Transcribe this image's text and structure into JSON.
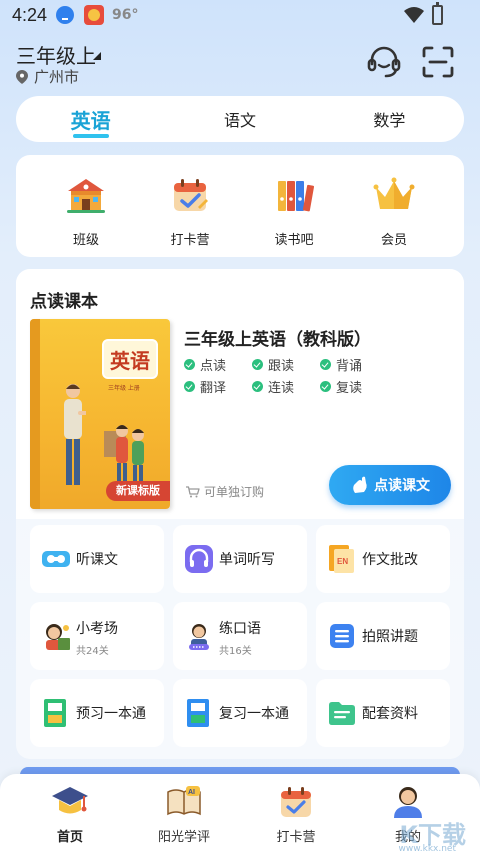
{
  "status_bar": {
    "time": "4:24",
    "temperature": "96°"
  },
  "header": {
    "grade": "三年级上",
    "location": "广州市"
  },
  "subject_tabs": [
    {
      "label": "英语",
      "active": true
    },
    {
      "label": "语文",
      "active": false
    },
    {
      "label": "数学",
      "active": false
    }
  ],
  "quick_entries": [
    {
      "label": "班级",
      "icon": "school-icon"
    },
    {
      "label": "打卡营",
      "icon": "checkin-calendar-icon"
    },
    {
      "label": "读书吧",
      "icon": "books-icon"
    },
    {
      "label": "会员",
      "icon": "crown-icon"
    }
  ],
  "textbook": {
    "section_title": "点读课本",
    "book_cover_title": "英语",
    "book_cover_grade": "三年级 上册",
    "book_badge": "新课标版",
    "book_name": "三年级上英语（教科版）",
    "features": [
      "点读",
      "跟读",
      "背诵",
      "翻译",
      "连读",
      "复读"
    ],
    "buy_link": "可单独订购",
    "read_button": "点读课文"
  },
  "tools": [
    {
      "label": "听课文",
      "sub": "",
      "icon": "listen-icon"
    },
    {
      "label": "单词听写",
      "sub": "",
      "icon": "headphones-icon"
    },
    {
      "label": "作文批改",
      "sub": "",
      "icon": "essay-icon"
    },
    {
      "label": "小考场",
      "sub": "共24关",
      "icon": "exam-girl-icon"
    },
    {
      "label": "练口语",
      "sub": "共16关",
      "icon": "speaking-boy-icon"
    },
    {
      "label": "拍照讲题",
      "sub": "",
      "icon": "photo-list-icon"
    },
    {
      "label": "预习一本通",
      "sub": "",
      "icon": "preview-book-icon"
    },
    {
      "label": "复习一本通",
      "sub": "",
      "icon": "review-book-icon"
    },
    {
      "label": "配套资料",
      "sub": "",
      "icon": "folder-icon"
    }
  ],
  "bottom_nav": [
    {
      "label": "首页",
      "active": true,
      "icon": "graduation-cap-icon"
    },
    {
      "label": "阳光学评",
      "active": false,
      "icon": "ai-book-icon"
    },
    {
      "label": "打卡营",
      "active": false,
      "icon": "checkin-calendar-icon"
    },
    {
      "label": "我的",
      "active": false,
      "icon": "profile-icon"
    }
  ],
  "watermark": {
    "text": "K下载",
    "sub": "www.kkx.net"
  },
  "colors": {
    "accent": "#1aa3d6",
    "primary_button": "#1e86e8",
    "check": "#2bbf7e",
    "badge": "#d64533"
  }
}
